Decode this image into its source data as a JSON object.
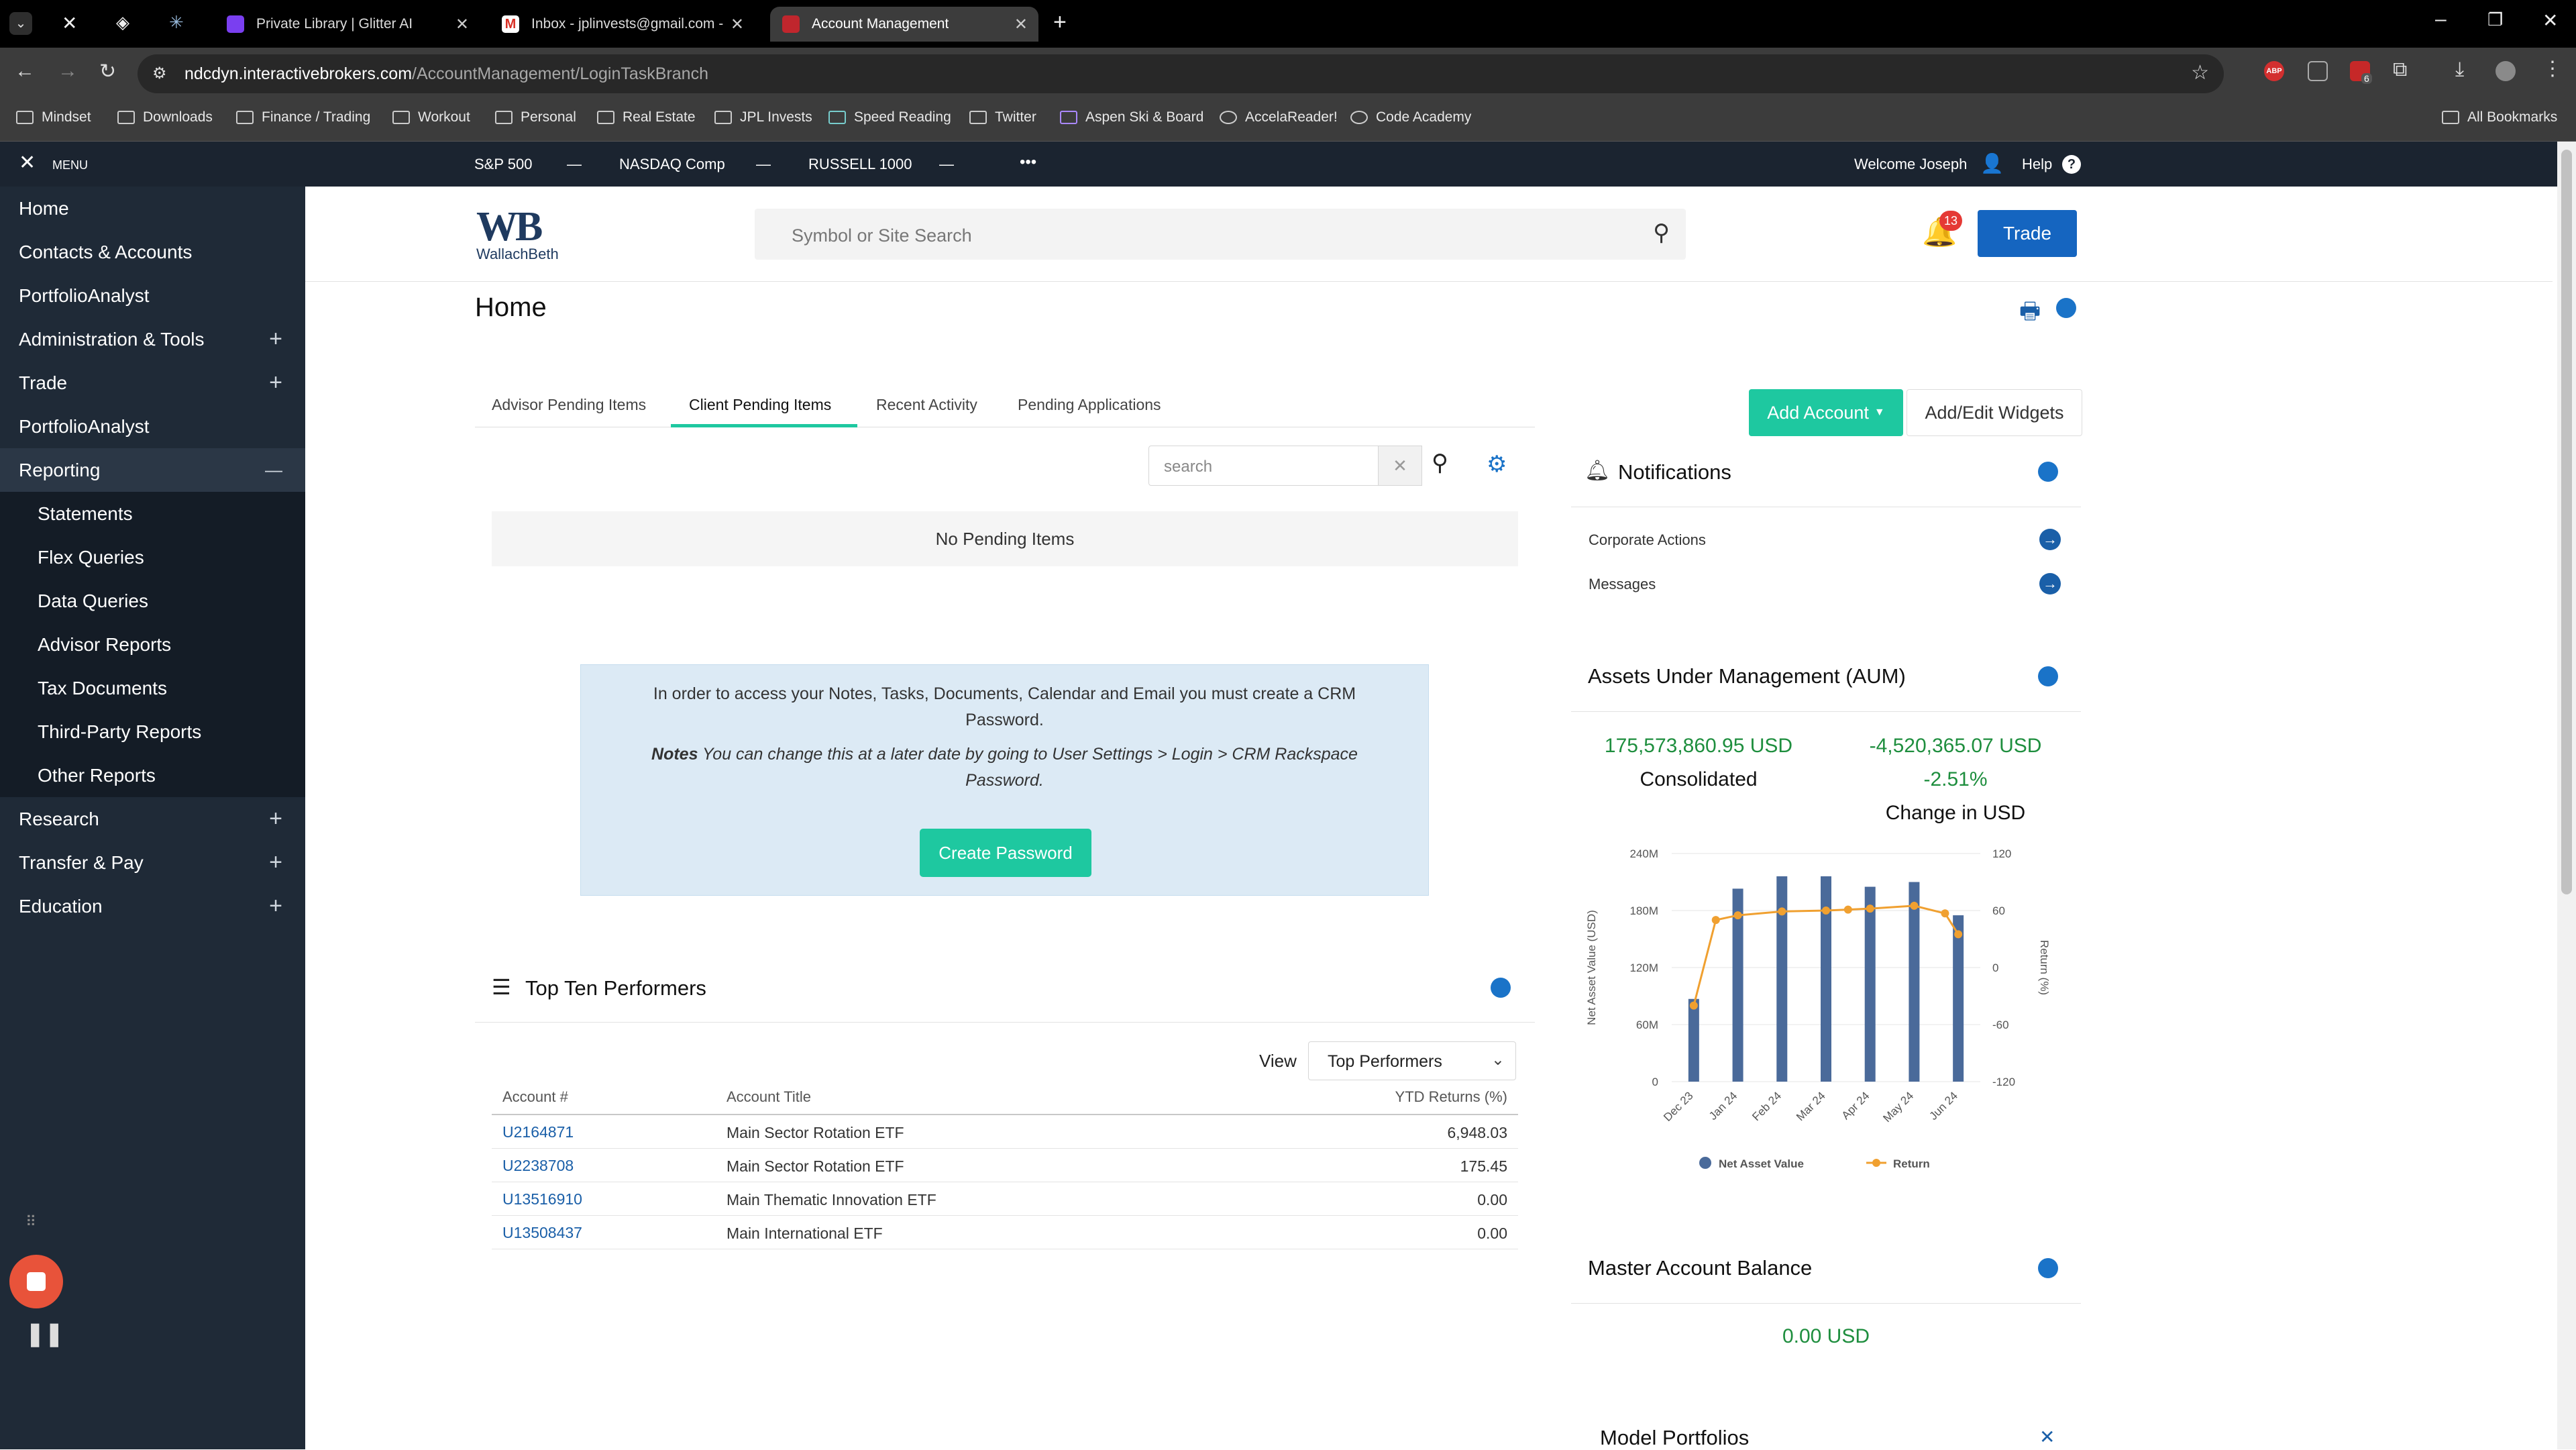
{
  "browser": {
    "tabs": [
      {
        "label": "Private Library | Glitter AI"
      },
      {
        "label": "Inbox - jplinvests@gmail.com -"
      },
      {
        "label": "Account Management"
      }
    ],
    "url_host": "ndcdyn.interactivebrokers.com",
    "url_path": "/AccountManagement/LoginTaskBranch",
    "bookmarks": [
      "Mindset",
      "Downloads",
      "Finance / Trading",
      "Workout",
      "Personal",
      "Real Estate",
      "JPL Invests",
      "Speed Reading",
      "Twitter",
      "Aspen Ski & Board",
      "AccelaReader!",
      "Code Academy"
    ],
    "all_bookmarks": "All Bookmarks",
    "ext_badge": "6"
  },
  "topbar": {
    "menu": "MENU",
    "indices": [
      {
        "name": "S&P 500",
        "value": "—"
      },
      {
        "name": "NASDAQ Comp",
        "value": "—"
      },
      {
        "name": "RUSSELL 1000",
        "value": "—"
      }
    ],
    "more": "•••",
    "welcome": "Welcome Joseph",
    "help": "Help"
  },
  "sidebar": {
    "items": [
      {
        "label": "Home",
        "expand": ""
      },
      {
        "label": "Contacts & Accounts",
        "expand": ""
      },
      {
        "label": "PortfolioAnalyst",
        "expand": ""
      },
      {
        "label": "Administration & Tools",
        "expand": "+"
      },
      {
        "label": "Trade",
        "expand": "+"
      },
      {
        "label": "PortfolioAnalyst",
        "expand": ""
      },
      {
        "label": "Reporting",
        "expand": "—"
      },
      {
        "label": "Statements",
        "expand": ""
      },
      {
        "label": "Flex Queries",
        "expand": ""
      },
      {
        "label": "Data Queries",
        "expand": ""
      },
      {
        "label": "Advisor Reports",
        "expand": ""
      },
      {
        "label": "Tax Documents",
        "expand": ""
      },
      {
        "label": "Third-Party Reports",
        "expand": ""
      },
      {
        "label": "Other Reports",
        "expand": ""
      },
      {
        "label": "Research",
        "expand": "+"
      },
      {
        "label": "Transfer & Pay",
        "expand": "+"
      },
      {
        "label": "Education",
        "expand": "+"
      }
    ]
  },
  "header": {
    "logo_mark": "WB",
    "logo_text": "WallachBeth",
    "search_placeholder": "Symbol or Site Search",
    "notif_count": "13",
    "trade_label": "Trade"
  },
  "page": {
    "title": "Home",
    "tabs": [
      "Advisor Pending Items",
      "Client Pending Items",
      "Recent Activity",
      "Pending Applications"
    ],
    "active_tab": "Client Pending Items",
    "pending_search_placeholder": "search",
    "no_items": "No Pending Items",
    "crm_line1": "In order to access your Notes, Tasks, Documents, Calendar and Email you must create a CRM Password.",
    "crm_notes_label": "Notes",
    "crm_notes_text": "You can change this at a later date by going to User Settings > Login > CRM Rackspace Password.",
    "create_password": "Create Password",
    "add_account": "Add Account",
    "add_edit_widgets": "Add/Edit Widgets"
  },
  "performers": {
    "title": "Top Ten Performers",
    "view_label": "View",
    "view_value": "Top Performers",
    "columns": [
      "Account #",
      "Account Title",
      "YTD Returns (%)"
    ],
    "rows": [
      {
        "account": "U2164871",
        "title": "Main Sector Rotation ETF",
        "ytd": "6,948.03"
      },
      {
        "account": "U2238708",
        "title": "Main Sector Rotation ETF",
        "ytd": "175.45"
      },
      {
        "account": "U13516910",
        "title": "Main Thematic Innovation ETF",
        "ytd": "0.00"
      },
      {
        "account": "U13508437",
        "title": "Main International ETF",
        "ytd": "0.00"
      }
    ]
  },
  "notifications": {
    "title": "Notifications",
    "items": [
      "Corporate Actions",
      "Messages"
    ]
  },
  "aum": {
    "title": "Assets Under Management (AUM)",
    "consolidated_value": "175,573,860.95 USD",
    "consolidated_label": "Consolidated",
    "change_value": "-4,520,365.07 USD",
    "change_pct": "-2.51%",
    "change_label": "Change in USD"
  },
  "chart_data": {
    "type": "bar",
    "categories": [
      "Dec 23",
      "Jan 24",
      "Feb 24",
      "Mar 24",
      "Apr 24",
      "May 24",
      "Jun 24"
    ],
    "series": [
      {
        "name": "Net Asset Value",
        "values": [
          [
            87
          ],
          [
            203
          ],
          [
            216
          ],
          [
            216
          ],
          [
            205
          ],
          [
            210
          ],
          [
            175
          ]
        ],
        "color": "#4a6a9a"
      },
      {
        "name": "Return",
        "values": [
          [
            -40
          ],
          [
            -11
          ],
          [
            55
          ],
          [
            60
          ],
          [
            60
          ],
          [
            62
          ],
          [
            63
          ],
          [
            66
          ],
          [
            57
          ],
          [
            35
          ]
        ],
        "color": "#f0a030"
      }
    ],
    "bar_values": [
      87,
      203,
      216,
      216,
      205,
      210,
      175
    ],
    "return_x": [
      0,
      0.5,
      1,
      2,
      3,
      3.5,
      4,
      5,
      5.7,
      6
    ],
    "return_values": [
      -40,
      50,
      55,
      59,
      60,
      61,
      62,
      65,
      57,
      35
    ],
    "ylabel": "Net Asset Value (USD)",
    "y2label": "Return (%)",
    "yticks": [
      "0",
      "60M",
      "120M",
      "180M",
      "240M"
    ],
    "y2ticks": [
      "-120",
      "-60",
      "0",
      "60",
      "120"
    ],
    "ylim": [
      0,
      240
    ],
    "y2lim": [
      -120,
      120
    ],
    "legend": [
      "Net Asset Value",
      "Return"
    ]
  },
  "balance": {
    "title": "Master Account Balance",
    "value": "0.00 USD"
  },
  "model": {
    "title": "Model Portfolios"
  }
}
